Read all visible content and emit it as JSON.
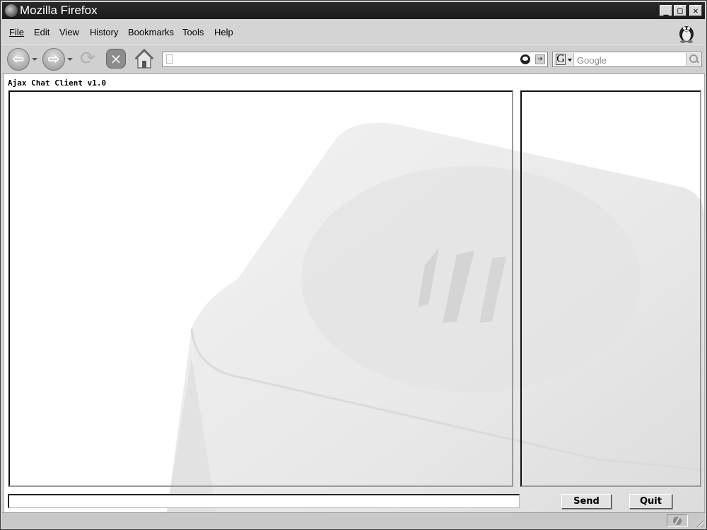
{
  "window": {
    "title": "Mozilla Firefox",
    "controls": {
      "minimize": "_",
      "maximize": "□",
      "close": "✕"
    }
  },
  "menubar": {
    "items": [
      {
        "label": "File",
        "access_key": "F"
      },
      {
        "label": "Edit",
        "access_key": "E"
      },
      {
        "label": "View",
        "access_key": "V"
      },
      {
        "label": "History",
        "access_key": "s"
      },
      {
        "label": "Bookmarks",
        "access_key": "B"
      },
      {
        "label": "Tools",
        "access_key": "T"
      },
      {
        "label": "Help",
        "access_key": "H"
      }
    ]
  },
  "toolbar": {
    "back_icon": "back-arrow-icon",
    "forward_icon": "forward-arrow-icon",
    "reload_icon": "reload-icon",
    "stop_icon": "stop-icon",
    "home_icon": "home-icon",
    "url_value": "",
    "search_placeholder": "Google",
    "search_engine_letter": "G"
  },
  "page": {
    "title": "Ajax Chat Client v1.0",
    "message_input_value": "",
    "send_label": "Send",
    "quit_label": "Quit"
  },
  "statusbar": {
    "text": ""
  }
}
